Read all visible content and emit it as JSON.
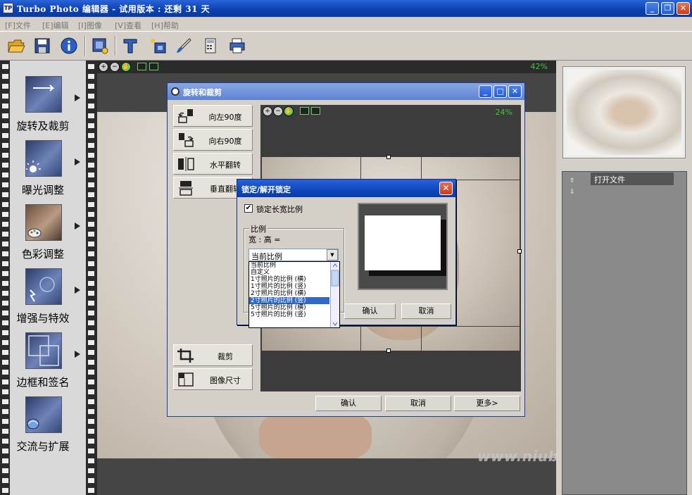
{
  "window": {
    "title": "Turbo Photo 编辑器 - 试用版本 : 还剩 31 天"
  },
  "menu": [
    "[F]文件",
    "[E]编辑",
    "[I]图像",
    "[V]查看",
    "[H]帮助"
  ],
  "toolbar": {
    "icons": [
      "open-folder-icon",
      "save-icon",
      "info-icon",
      "batch-icon",
      "text-tool-icon",
      "frame-tool-icon",
      "brush-tool-icon",
      "calculator-icon",
      "print-icon"
    ]
  },
  "viewport": {
    "zoom": "42%",
    "watermark": "www.niubb.net"
  },
  "tools": [
    {
      "label": "旋转及裁剪",
      "icon": "rotate-crop-icon"
    },
    {
      "label": "曝光调整",
      "icon": "exposure-icon"
    },
    {
      "label": "色彩调整",
      "icon": "color-palette-icon"
    },
    {
      "label": "增强与特效",
      "icon": "effects-icon"
    },
    {
      "label": "边框和签名",
      "icon": "frame-signature-icon"
    },
    {
      "label": "交流与扩展",
      "icon": "share-extend-icon"
    }
  ],
  "history": {
    "items": [
      "打开文件"
    ]
  },
  "rotate_dialog": {
    "title": "旋转和裁剪",
    "zoom": "24%",
    "buttons": [
      "向左90度",
      "向右90度",
      "水平翻转",
      "垂直翻转"
    ],
    "crop": "裁剪",
    "image_size": "图像尺寸",
    "ok": "确认",
    "cancel": "取消",
    "more": "更多>"
  },
  "lock_dialog": {
    "title": "锁定/解开锁定",
    "checkbox_label": "锁定长宽比例",
    "checked": true,
    "group_title": "比例",
    "ratio_label": "宽 : 高 =",
    "selected": "当前比例",
    "options": [
      "当前比例",
      "自定义",
      "1寸照片的比例 (横)",
      "1寸照片的比例 (竖)",
      "2寸照片的比例 (横)",
      "2寸照片的比例 (竖)",
      "5寸照片的比例 (横)",
      "5寸照片的比例 (竖)"
    ],
    "highlighted_option": "2寸照片的比例 (竖)",
    "ok": "确认",
    "cancel": "取消"
  }
}
